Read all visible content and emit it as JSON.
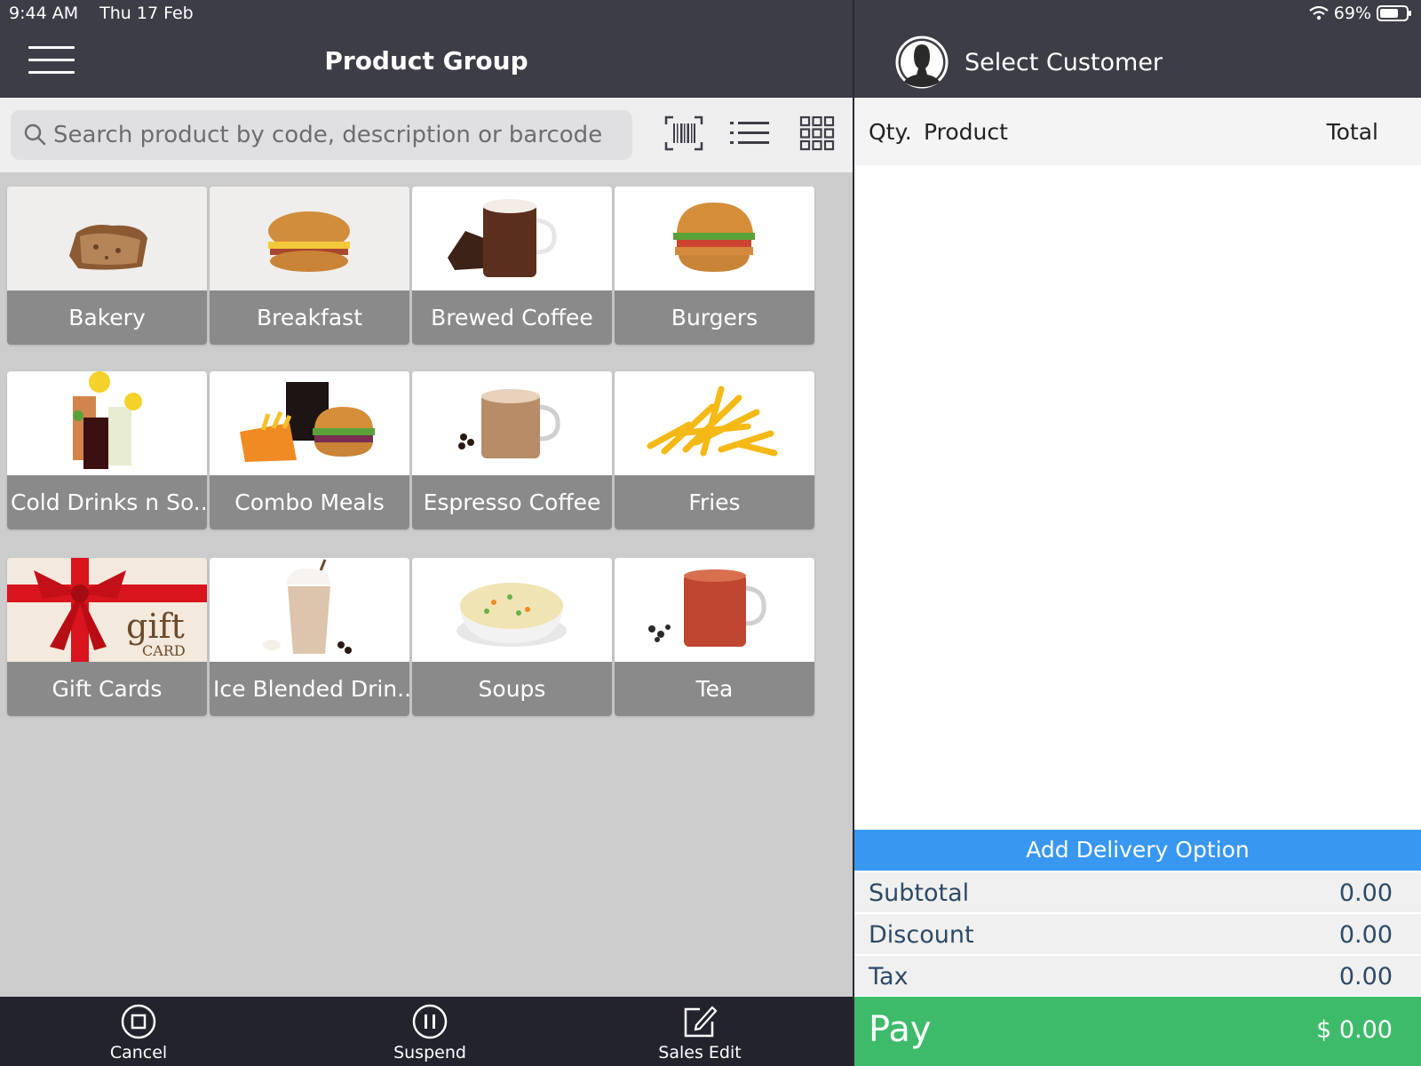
{
  "status_bar": {
    "time": "9:44 AM",
    "date": "Thu 17 Feb",
    "battery": "69%"
  },
  "header": {
    "title": "Product Group",
    "customer_label": "Select Customer"
  },
  "search": {
    "placeholder": "Search product by code, description or barcode"
  },
  "groups": [
    {
      "label": "Bakery",
      "icon": "bread-slice-image"
    },
    {
      "label": "Breakfast",
      "icon": "breakfast-sandwich-image"
    },
    {
      "label": "Brewed Coffee",
      "icon": "coffee-mug-image"
    },
    {
      "label": "Burgers",
      "icon": "burger-image"
    },
    {
      "label": "Cold Drinks n So...",
      "icon": "cold-drinks-image"
    },
    {
      "label": "Combo Meals",
      "icon": "combo-meal-image"
    },
    {
      "label": "Espresso Coffee",
      "icon": "espresso-mug-image"
    },
    {
      "label": "Fries",
      "icon": "fries-image"
    },
    {
      "label": "Gift Cards",
      "icon": "gift-card-image"
    },
    {
      "label": "Ice Blended Drin...",
      "icon": "ice-blended-drink-image"
    },
    {
      "label": "Soups",
      "icon": "soup-bowl-image"
    },
    {
      "label": "Tea",
      "icon": "tea-mug-image"
    }
  ],
  "gift_card_text": {
    "line1": "gift",
    "line2": "CARD"
  },
  "order": {
    "col_qty": "Qty.",
    "col_product": "Product",
    "col_total": "Total",
    "delivery": "Add Delivery Option",
    "subtotal_label": "Subtotal",
    "subtotal": "0.00",
    "discount_label": "Discount",
    "discount": "0.00",
    "tax_label": "Tax",
    "tax": "0.00",
    "pay_label": "Pay",
    "pay_amount": "$ 0.00"
  },
  "actions": {
    "cancel": "Cancel",
    "suspend": "Suspend",
    "sales_edit": "Sales Edit"
  },
  "colors": {
    "header_bg": "#3c3d46",
    "tile_label_bg": "#8a8a8a",
    "delivery_bg": "#3897f0",
    "pay_bg": "#3ebb6a",
    "summary_text": "#2c4a67"
  }
}
